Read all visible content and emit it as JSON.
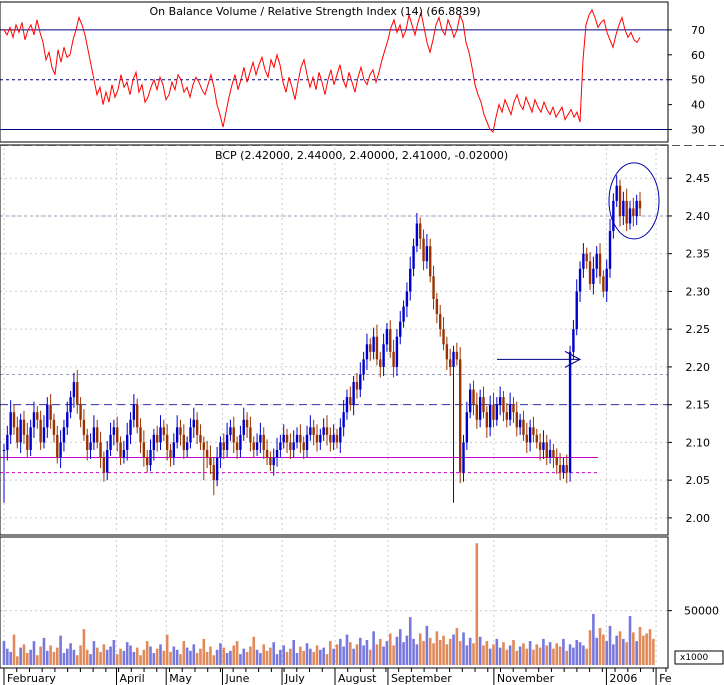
{
  "chart_data": [
    {
      "type": "line",
      "panel": "indicator",
      "title": "On Balance Volume / Relative Strength Index (14) (66.8839)",
      "ylim": [
        25,
        80
      ],
      "yticks": [
        "30",
        "40",
        "50",
        "60",
        "70"
      ],
      "reference_lines": [
        70,
        50,
        30
      ],
      "grid": false,
      "color": "#ff0000",
      "series": [
        {
          "values": [
            70,
            68,
            71,
            67,
            72,
            69,
            73,
            66,
            70,
            72,
            68,
            74,
            69,
            65,
            58,
            61,
            55,
            52,
            62,
            57,
            63,
            59,
            60,
            66,
            70,
            75,
            72,
            68,
            62,
            56,
            50,
            44,
            47,
            40,
            45,
            41,
            48,
            43,
            46,
            52,
            47,
            49,
            44,
            50,
            53,
            45,
            48,
            41,
            43,
            47,
            50,
            46,
            51,
            48,
            42,
            44,
            49,
            46,
            52,
            50,
            45,
            47,
            43,
            48,
            51,
            49,
            46,
            44,
            48,
            52,
            47,
            40,
            36,
            31,
            37,
            43,
            48,
            52,
            46,
            50,
            55,
            49,
            53,
            57,
            52,
            56,
            59,
            54,
            51,
            58,
            55,
            60,
            56,
            49,
            45,
            51,
            47,
            42,
            49,
            55,
            58,
            52,
            47,
            51,
            46,
            53,
            49,
            44,
            50,
            54,
            48,
            52,
            56,
            50,
            47,
            53,
            49,
            45,
            51,
            55,
            50,
            48,
            52,
            54,
            49,
            53,
            58,
            62,
            66,
            71,
            74,
            69,
            72,
            67,
            70,
            76,
            72,
            68,
            73,
            77,
            71,
            65,
            61,
            66,
            72,
            75,
            70,
            68,
            74,
            71,
            67,
            70,
            76,
            73,
            65,
            61,
            55,
            48,
            44,
            41,
            36,
            33,
            30,
            29,
            35,
            40,
            37,
            42,
            39,
            36,
            41,
            44,
            40,
            38,
            43,
            40,
            37,
            42,
            39,
            37,
            41,
            38,
            36,
            39,
            35,
            37,
            39,
            34,
            36,
            38,
            35,
            37,
            33,
            58,
            72,
            76,
            78,
            75,
            71,
            73,
            74,
            69,
            66,
            63,
            68,
            72,
            75,
            70,
            67,
            69,
            66,
            65,
            67
          ]
        }
      ]
    },
    {
      "type": "candlestick",
      "panel": "price",
      "title": "BCP (2.42000, 2.44000, 2.40000, 2.41000, -0.02000)",
      "ylim": [
        1.98,
        2.49
      ],
      "yticks": [
        "2.00",
        "2.05",
        "2.10",
        "2.15",
        "2.20",
        "2.25",
        "2.30",
        "2.35",
        "2.40",
        "2.45"
      ],
      "grid": true,
      "up_color": "#0000cc",
      "down_color": "#993300",
      "support_lines": [
        2.08,
        2.06
      ],
      "resistance_lines": [
        2.15,
        2.19,
        2.4
      ],
      "series": [
        {
          "close": [
            2.09,
            2.11,
            2.14,
            2.12,
            2.1,
            2.13,
            2.11,
            2.09,
            2.12,
            2.14,
            2.13,
            2.1,
            2.12,
            2.15,
            2.13,
            2.11,
            2.08,
            2.1,
            2.12,
            2.14,
            2.16,
            2.18,
            2.15,
            2.13,
            2.11,
            2.09,
            2.1,
            2.12,
            2.1,
            2.08,
            2.06,
            2.09,
            2.11,
            2.12,
            2.1,
            2.08,
            2.09,
            2.11,
            2.13,
            2.15,
            2.12,
            2.1,
            2.08,
            2.07,
            2.09,
            2.11,
            2.1,
            2.12,
            2.11,
            2.09,
            2.08,
            2.1,
            2.12,
            2.11,
            2.09,
            2.1,
            2.12,
            2.13,
            2.11,
            2.1,
            2.09,
            2.08,
            2.07,
            2.05,
            2.08,
            2.1,
            2.09,
            2.11,
            2.12,
            2.1,
            2.09,
            2.11,
            2.13,
            2.12,
            2.1,
            2.09,
            2.1,
            2.11,
            2.09,
            2.08,
            2.07,
            2.08,
            2.09,
            2.1,
            2.11,
            2.1,
            2.09,
            2.1,
            2.11,
            2.1,
            2.09,
            2.11,
            2.12,
            2.11,
            2.1,
            2.11,
            2.12,
            2.11,
            2.1,
            2.11,
            2.1,
            2.12,
            2.14,
            2.16,
            2.15,
            2.18,
            2.17,
            2.19,
            2.21,
            2.23,
            2.22,
            2.24,
            2.21,
            2.2,
            2.23,
            2.25,
            2.22,
            2.2,
            2.24,
            2.26,
            2.28,
            2.3,
            2.33,
            2.36,
            2.39,
            2.37,
            2.34,
            2.36,
            2.32,
            2.29,
            2.27,
            2.25,
            2.23,
            2.21,
            2.2,
            2.22,
            2.21,
            2.06,
            2.1,
            2.14,
            2.17,
            2.15,
            2.13,
            2.16,
            2.14,
            2.12,
            2.15,
            2.13,
            2.15,
            2.16,
            2.14,
            2.13,
            2.15,
            2.14,
            2.12,
            2.13,
            2.11,
            2.1,
            2.12,
            2.11,
            2.1,
            2.09,
            2.1,
            2.08,
            2.09,
            2.08,
            2.07,
            2.06,
            2.07,
            2.06,
            2.22,
            2.25,
            2.3,
            2.33,
            2.35,
            2.34,
            2.31,
            2.33,
            2.35,
            2.32,
            2.3,
            2.33,
            2.38,
            2.42,
            2.44,
            2.4,
            2.42,
            2.39,
            2.41,
            2.4,
            2.42,
            2.41
          ]
        }
      ],
      "annotations": [
        "arrow",
        "circle"
      ]
    },
    {
      "type": "bar",
      "panel": "volume",
      "ylabel": "x1000",
      "yticks": [
        "50000"
      ],
      "up_color": "#7777dd",
      "down_color": "#e08a5c",
      "series": [
        {
          "values": [
            22000,
            15000,
            12000,
            28000,
            8000,
            16000,
            19000,
            11000,
            14000,
            22000,
            9000,
            17000,
            25000,
            13000,
            18000,
            12000,
            16000,
            27000,
            11000,
            15000,
            20000,
            14000,
            9000,
            18000,
            33000,
            14000,
            10000,
            22000,
            16000,
            12000,
            19000,
            14000,
            17000,
            23000,
            10000,
            15000,
            13000,
            21000,
            18000,
            12000,
            16000,
            9000,
            14000,
            22000,
            17000,
            11000,
            15000,
            19000,
            13000,
            28000,
            12000,
            17000,
            14000,
            10000,
            22000,
            16000,
            13000,
            19000,
            11000,
            15000,
            24000,
            12000,
            17000,
            9000,
            14000,
            20000,
            16000,
            11000,
            13000,
            18000,
            22000,
            10000,
            15000,
            12000,
            17000,
            26000,
            14000,
            11000,
            19000,
            13000,
            16000,
            21000,
            10000,
            14000,
            18000,
            12000,
            15000,
            23000,
            11000,
            17000,
            13000,
            20000,
            15000,
            12000,
            18000,
            14000,
            16000,
            10000,
            22000,
            15000,
            19000,
            24000,
            17000,
            28000,
            21000,
            15000,
            19000,
            25000,
            18000,
            23000,
            14000,
            31000,
            19000,
            24000,
            17000,
            22000,
            29000,
            18000,
            26000,
            33000,
            21000,
            27000,
            44000,
            24000,
            19000,
            29000,
            22000,
            36000,
            25000,
            20000,
            31000,
            23000,
            27000,
            19000,
            24000,
            28000,
            34000,
            22000,
            30000,
            18000,
            25000,
            20000,
            112000,
            26000,
            18000,
            22000,
            15000,
            19000,
            24000,
            16000,
            21000,
            14000,
            18000,
            23000,
            13000,
            17000,
            20000,
            15000,
            22000,
            14000,
            19000,
            16000,
            24000,
            18000,
            21000,
            15000,
            20000,
            17000,
            24000,
            13000,
            19000,
            16000,
            23000,
            21000,
            18000,
            15000,
            32000,
            47000,
            25000,
            34000,
            28000,
            22000,
            36000,
            19000,
            27000,
            31000,
            24000,
            21000,
            45000,
            30000,
            22000,
            35000,
            27000,
            29000,
            33000,
            24000
          ]
        }
      ]
    }
  ],
  "x_axis": {
    "labels": [
      "February",
      "April",
      "May",
      "June",
      "July",
      "August",
      "September",
      "November",
      "2006",
      "Fe"
    ]
  }
}
